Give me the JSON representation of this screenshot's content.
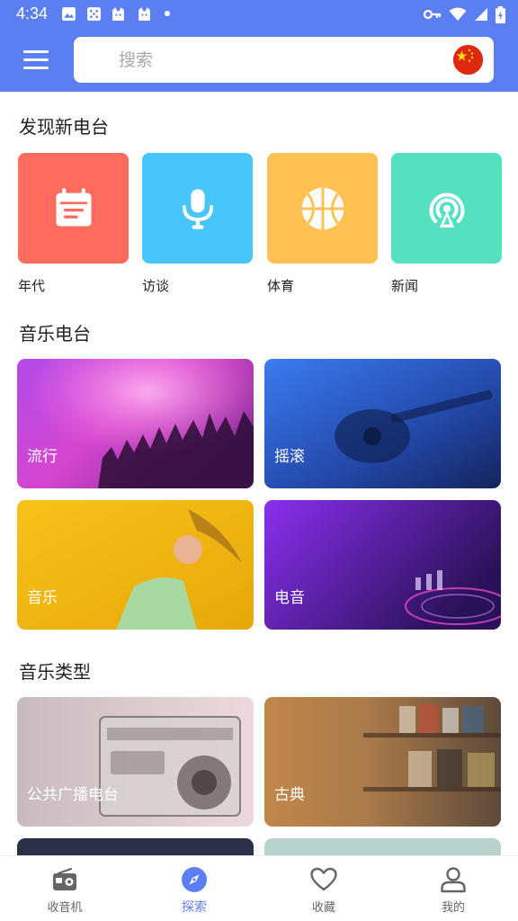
{
  "status_bar": {
    "time": "4:34"
  },
  "search": {
    "placeholder": "搜索"
  },
  "sections": {
    "discover": "发现新电台",
    "music_stations": "音乐电台",
    "music_genres": "音乐类型"
  },
  "discover": [
    {
      "label": "年代",
      "color": "#ff6b5c",
      "icon": "calendar-icon"
    },
    {
      "label": "访谈",
      "color": "#46c6fb",
      "icon": "microphone-icon"
    },
    {
      "label": "体育",
      "color": "#ffc153",
      "icon": "basketball-icon"
    },
    {
      "label": "新闻",
      "color": "#55e0c0",
      "icon": "broadcast-icon"
    }
  ],
  "music_stations": [
    {
      "label": "流行"
    },
    {
      "label": "摇滚"
    },
    {
      "label": "音乐"
    },
    {
      "label": "电音"
    }
  ],
  "music_genres": [
    {
      "label": "公共广播电台"
    },
    {
      "label": "古典"
    }
  ],
  "bottom_nav": [
    {
      "label": "收音机",
      "icon": "radio-icon"
    },
    {
      "label": "探索",
      "icon": "compass-icon",
      "active": true
    },
    {
      "label": "收藏",
      "icon": "heart-icon"
    },
    {
      "label": "我的",
      "icon": "user-icon"
    }
  ],
  "colors": {
    "accent": "#5b7ff2"
  }
}
